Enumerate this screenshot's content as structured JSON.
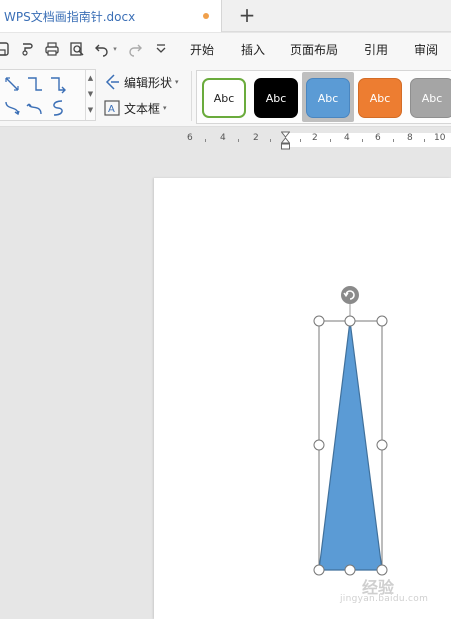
{
  "tab": {
    "title": "WPS文档画指南针.docx",
    "new_tab_label": "+"
  },
  "quick_toolbar": {
    "icons": [
      "save-icon",
      "format-painter-icon",
      "print-icon",
      "print-preview-icon",
      "undo-icon",
      "redo-icon",
      "customize-icon"
    ]
  },
  "menu": {
    "items": [
      "开始",
      "插入",
      "页面布局",
      "引用",
      "审阅"
    ]
  },
  "ribbon": {
    "edit_shape_label": "编辑形状",
    "text_box_label": "文本框",
    "style_gallery": [
      {
        "label": "Abc",
        "fill": "#ffffff",
        "border": "#6aab3c",
        "text": "#222222"
      },
      {
        "label": "Abc",
        "fill": "#000000",
        "border": "#000000",
        "text": "#ffffff"
      },
      {
        "label": "Abc",
        "fill": "#5b9bd5",
        "border": "#4a86c0",
        "text": "#ffffff",
        "selected": true
      },
      {
        "label": "Abc",
        "fill": "#ed7d31",
        "border": "#d36c26",
        "text": "#ffffff"
      },
      {
        "label": "Abc",
        "fill": "#a5a5a5",
        "border": "#8f8f8f",
        "text": "#ffffff"
      }
    ]
  },
  "ruler": {
    "labels": [
      "6",
      "4",
      "2",
      "2",
      "4",
      "6",
      "8",
      "10"
    ]
  },
  "shape": {
    "type": "isosceles-triangle",
    "fill": "#5b9bd5",
    "outline": "#41719c",
    "handle": "rotate-handle-icon"
  },
  "watermark": {
    "line1": "经验",
    "line2": "jingyan.baidu.com"
  },
  "colors": {
    "accent_tab_text": "#3b6fb6",
    "modified_dot": "#f0a04b"
  }
}
